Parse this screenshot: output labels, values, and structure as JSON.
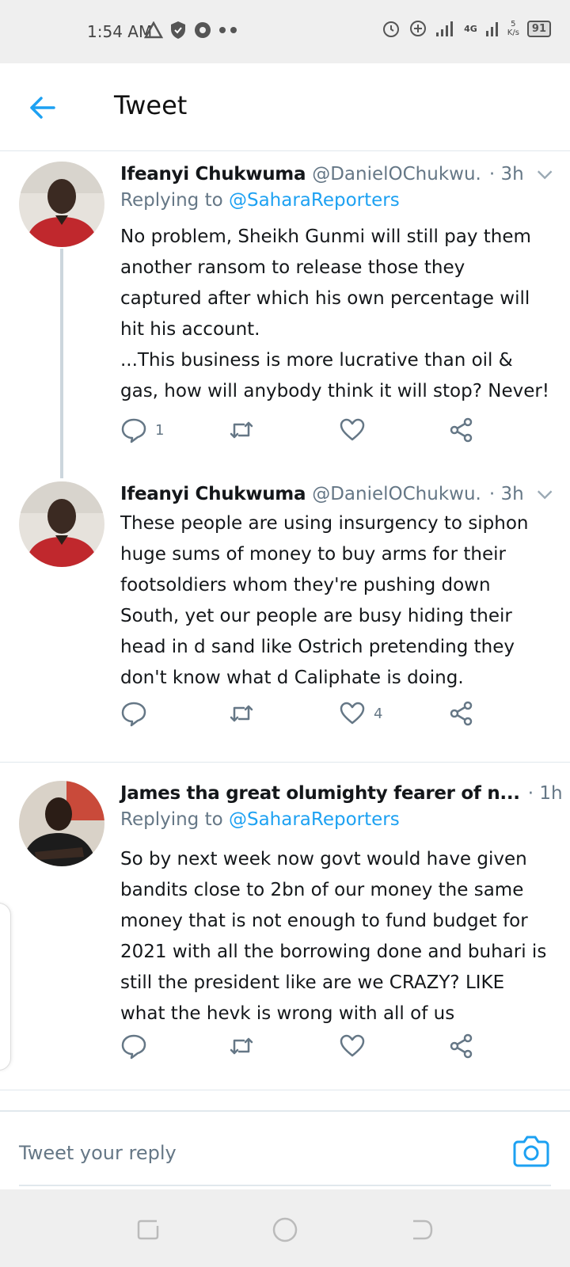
{
  "status_bar": {
    "time": "1:54 AM",
    "network": "4G",
    "speed_value": "5",
    "speed_unit": "K/s",
    "battery": "91"
  },
  "header": {
    "title": "Tweet"
  },
  "tweets": [
    {
      "name": "Ifeanyi Chukwuma",
      "handle": "@DanielOChukwu...",
      "time": "· 3h",
      "replying_prefix": "Replying to",
      "replying_to": "@SaharaReporters",
      "text_lines": [
        "No problem, Sheikh Gunmi will still pay them another ransom to release those they captured after which his own percentage will hit his account.",
        "...This business is more lucrative than oil & gas, how will anybody think it will stop? Never!"
      ],
      "reply_count": "1",
      "retweet_count": "",
      "like_count": ""
    },
    {
      "name": "Ifeanyi Chukwuma",
      "handle": "@DanielOChukwu...",
      "time": "· 3h",
      "text_lines": [
        "These people are using insurgency to siphon huge sums of money to buy arms for their footsoldiers whom they're pushing down South, yet our people are busy hiding their head in d sand like Ostrich pretending they don't know what d Caliphate is doing."
      ],
      "reply_count": "",
      "retweet_count": "",
      "like_count": "4"
    },
    {
      "name": "James tha great olumighty fearer of n...",
      "handle": "",
      "time": "· 1h",
      "replying_prefix": "Replying to",
      "replying_to": "@SaharaReporters",
      "text_lines": [
        "So by next week now govt would have given bandits close to 2bn of our money  the same money that is not enough to fund budget for 2021 with all the borrowing done and buhari is still the president like are we CRAZY? LIKE what the hevk is wrong with all of us"
      ],
      "reply_count": "",
      "retweet_count": "",
      "like_count": ""
    }
  ],
  "reply_bar": {
    "placeholder": "Tweet your reply"
  },
  "icons": {
    "back": "arrow-left-icon",
    "chevron": "chevron-down-icon",
    "reply": "comment-icon",
    "retweet": "retweet-icon",
    "like": "heart-icon",
    "share": "share-icon",
    "camera": "camera-icon"
  },
  "colors": {
    "accent": "#1da1f2",
    "muted": "#657786",
    "text": "#14171a",
    "divider": "#e1e8ed"
  }
}
